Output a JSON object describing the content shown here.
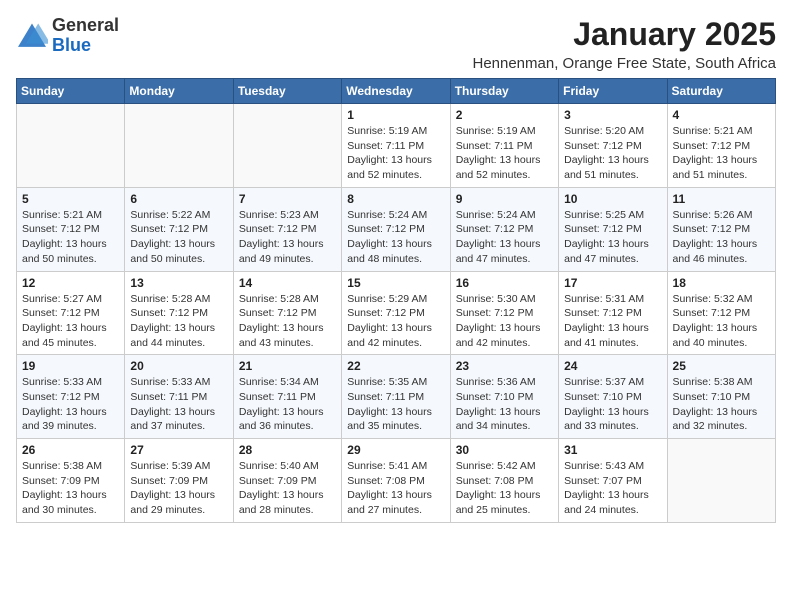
{
  "logo": {
    "general": "General",
    "blue": "Blue"
  },
  "header": {
    "title": "January 2025",
    "subtitle": "Hennenman, Orange Free State, South Africa"
  },
  "weekdays": [
    "Sunday",
    "Monday",
    "Tuesday",
    "Wednesday",
    "Thursday",
    "Friday",
    "Saturday"
  ],
  "weeks": [
    [
      {
        "day": "",
        "info": ""
      },
      {
        "day": "",
        "info": ""
      },
      {
        "day": "",
        "info": ""
      },
      {
        "day": "1",
        "info": "Sunrise: 5:19 AM\nSunset: 7:11 PM\nDaylight: 13 hours and 52 minutes."
      },
      {
        "day": "2",
        "info": "Sunrise: 5:19 AM\nSunset: 7:11 PM\nDaylight: 13 hours and 52 minutes."
      },
      {
        "day": "3",
        "info": "Sunrise: 5:20 AM\nSunset: 7:12 PM\nDaylight: 13 hours and 51 minutes."
      },
      {
        "day": "4",
        "info": "Sunrise: 5:21 AM\nSunset: 7:12 PM\nDaylight: 13 hours and 51 minutes."
      }
    ],
    [
      {
        "day": "5",
        "info": "Sunrise: 5:21 AM\nSunset: 7:12 PM\nDaylight: 13 hours and 50 minutes."
      },
      {
        "day": "6",
        "info": "Sunrise: 5:22 AM\nSunset: 7:12 PM\nDaylight: 13 hours and 50 minutes."
      },
      {
        "day": "7",
        "info": "Sunrise: 5:23 AM\nSunset: 7:12 PM\nDaylight: 13 hours and 49 minutes."
      },
      {
        "day": "8",
        "info": "Sunrise: 5:24 AM\nSunset: 7:12 PM\nDaylight: 13 hours and 48 minutes."
      },
      {
        "day": "9",
        "info": "Sunrise: 5:24 AM\nSunset: 7:12 PM\nDaylight: 13 hours and 47 minutes."
      },
      {
        "day": "10",
        "info": "Sunrise: 5:25 AM\nSunset: 7:12 PM\nDaylight: 13 hours and 47 minutes."
      },
      {
        "day": "11",
        "info": "Sunrise: 5:26 AM\nSunset: 7:12 PM\nDaylight: 13 hours and 46 minutes."
      }
    ],
    [
      {
        "day": "12",
        "info": "Sunrise: 5:27 AM\nSunset: 7:12 PM\nDaylight: 13 hours and 45 minutes."
      },
      {
        "day": "13",
        "info": "Sunrise: 5:28 AM\nSunset: 7:12 PM\nDaylight: 13 hours and 44 minutes."
      },
      {
        "day": "14",
        "info": "Sunrise: 5:28 AM\nSunset: 7:12 PM\nDaylight: 13 hours and 43 minutes."
      },
      {
        "day": "15",
        "info": "Sunrise: 5:29 AM\nSunset: 7:12 PM\nDaylight: 13 hours and 42 minutes."
      },
      {
        "day": "16",
        "info": "Sunrise: 5:30 AM\nSunset: 7:12 PM\nDaylight: 13 hours and 42 minutes."
      },
      {
        "day": "17",
        "info": "Sunrise: 5:31 AM\nSunset: 7:12 PM\nDaylight: 13 hours and 41 minutes."
      },
      {
        "day": "18",
        "info": "Sunrise: 5:32 AM\nSunset: 7:12 PM\nDaylight: 13 hours and 40 minutes."
      }
    ],
    [
      {
        "day": "19",
        "info": "Sunrise: 5:33 AM\nSunset: 7:12 PM\nDaylight: 13 hours and 39 minutes."
      },
      {
        "day": "20",
        "info": "Sunrise: 5:33 AM\nSunset: 7:11 PM\nDaylight: 13 hours and 37 minutes."
      },
      {
        "day": "21",
        "info": "Sunrise: 5:34 AM\nSunset: 7:11 PM\nDaylight: 13 hours and 36 minutes."
      },
      {
        "day": "22",
        "info": "Sunrise: 5:35 AM\nSunset: 7:11 PM\nDaylight: 13 hours and 35 minutes."
      },
      {
        "day": "23",
        "info": "Sunrise: 5:36 AM\nSunset: 7:10 PM\nDaylight: 13 hours and 34 minutes."
      },
      {
        "day": "24",
        "info": "Sunrise: 5:37 AM\nSunset: 7:10 PM\nDaylight: 13 hours and 33 minutes."
      },
      {
        "day": "25",
        "info": "Sunrise: 5:38 AM\nSunset: 7:10 PM\nDaylight: 13 hours and 32 minutes."
      }
    ],
    [
      {
        "day": "26",
        "info": "Sunrise: 5:38 AM\nSunset: 7:09 PM\nDaylight: 13 hours and 30 minutes."
      },
      {
        "day": "27",
        "info": "Sunrise: 5:39 AM\nSunset: 7:09 PM\nDaylight: 13 hours and 29 minutes."
      },
      {
        "day": "28",
        "info": "Sunrise: 5:40 AM\nSunset: 7:09 PM\nDaylight: 13 hours and 28 minutes."
      },
      {
        "day": "29",
        "info": "Sunrise: 5:41 AM\nSunset: 7:08 PM\nDaylight: 13 hours and 27 minutes."
      },
      {
        "day": "30",
        "info": "Sunrise: 5:42 AM\nSunset: 7:08 PM\nDaylight: 13 hours and 25 minutes."
      },
      {
        "day": "31",
        "info": "Sunrise: 5:43 AM\nSunset: 7:07 PM\nDaylight: 13 hours and 24 minutes."
      },
      {
        "day": "",
        "info": ""
      }
    ]
  ]
}
